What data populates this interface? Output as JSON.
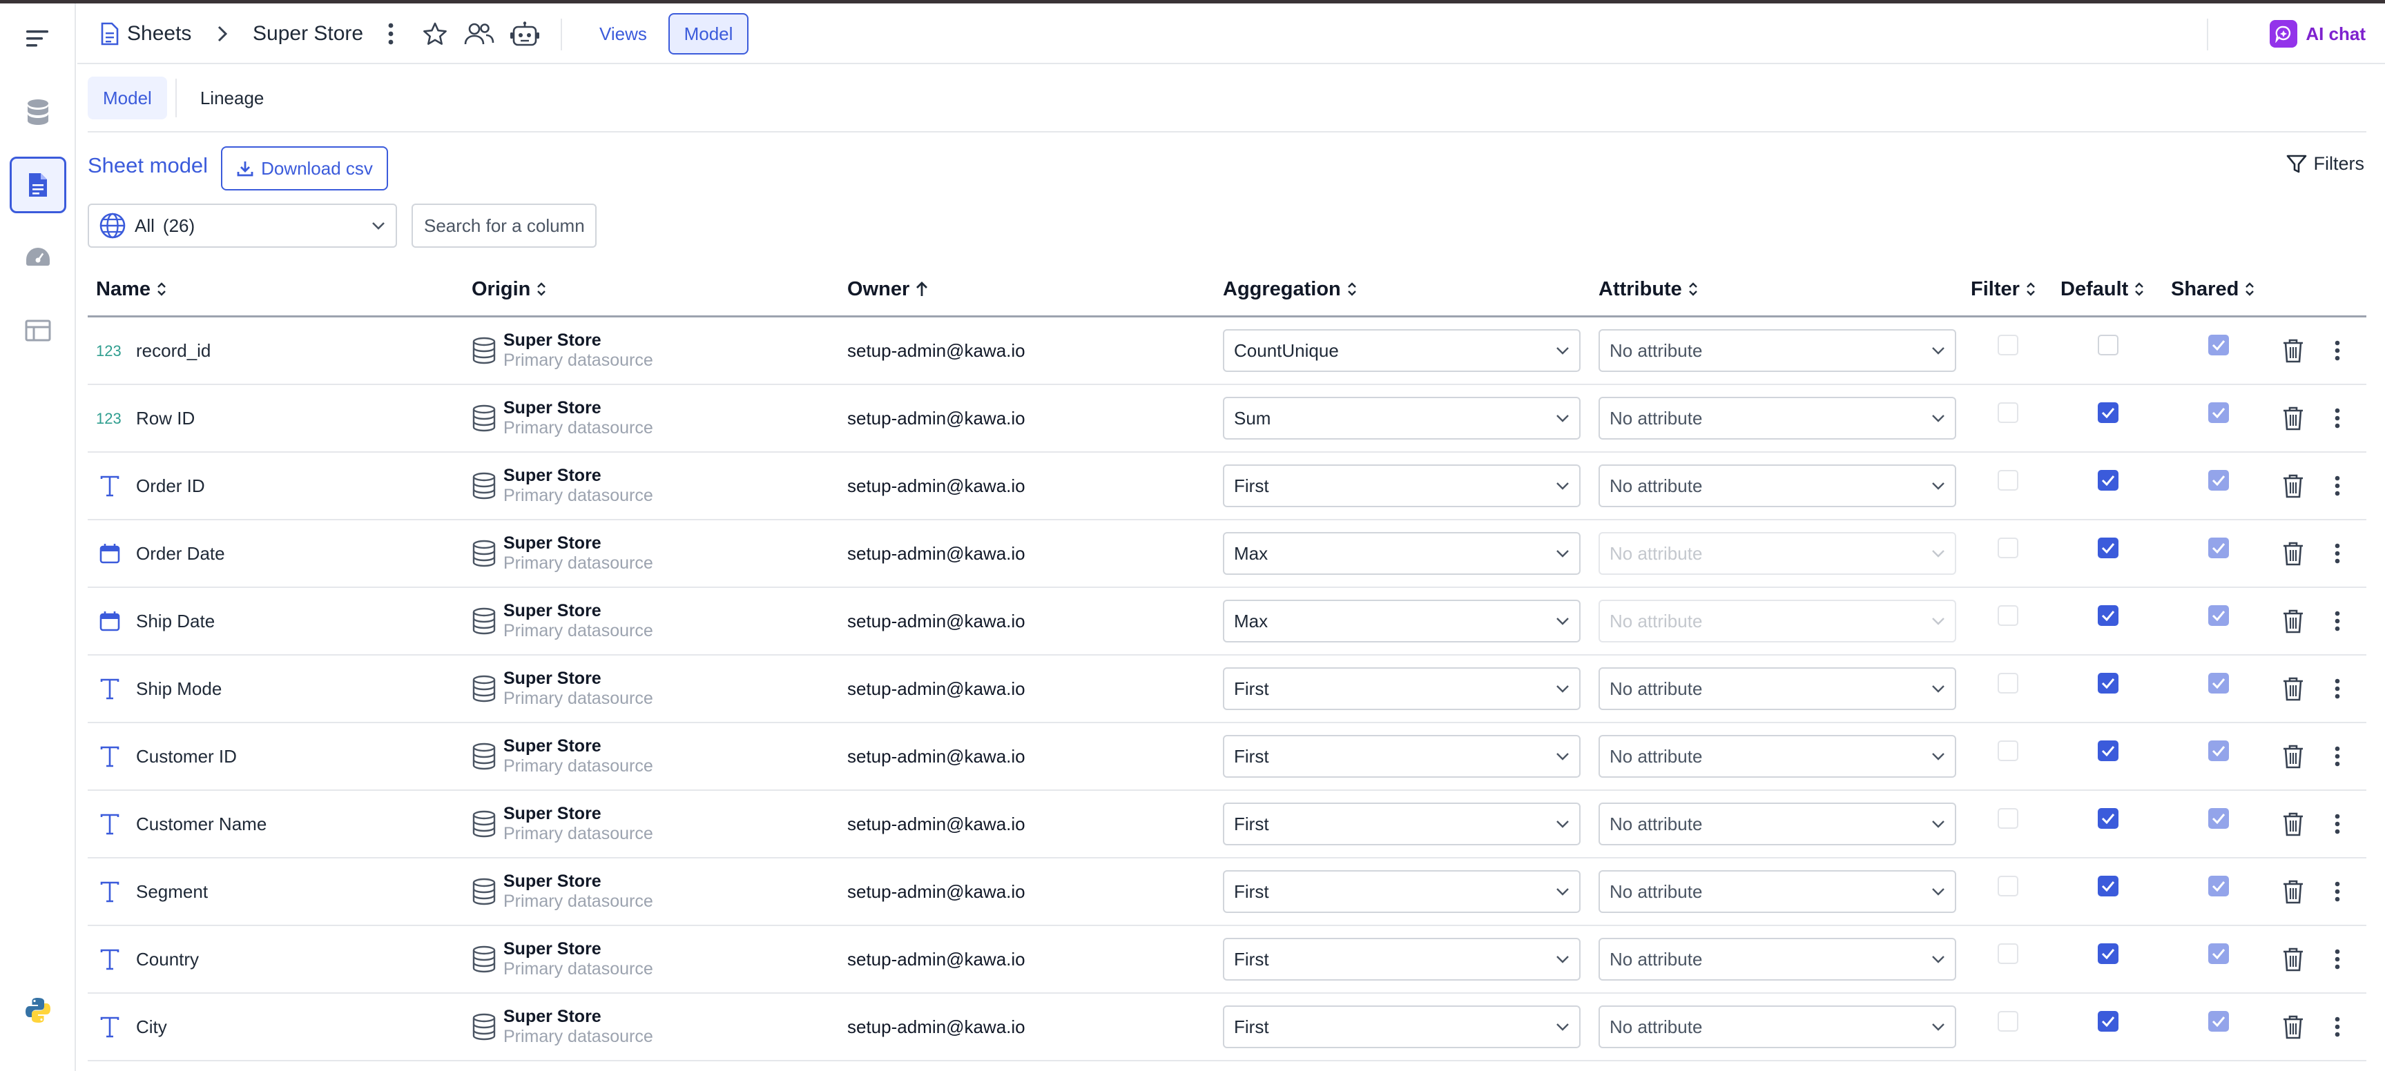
{
  "topbar": {
    "breadcrumb_root": "Sheets",
    "sheet_name": "Super Store",
    "views_label": "Views",
    "model_label": "Model",
    "ai_chat_label": "AI chat"
  },
  "sidebar": {
    "items": [
      {
        "icon": "menu-icon"
      },
      {
        "icon": "database-icon"
      },
      {
        "icon": "sheet-icon",
        "active": true
      },
      {
        "icon": "dashboard-icon"
      },
      {
        "icon": "table-icon"
      },
      {
        "icon": "python-icon"
      }
    ]
  },
  "tabs": [
    {
      "label": "Model",
      "active": true
    },
    {
      "label": "Lineage",
      "active": false
    }
  ],
  "sheet_model": {
    "title": "Sheet model",
    "download_label": "Download csv",
    "filters_label": "Filters",
    "column_filter": "All",
    "column_count": "(26)",
    "search_placeholder": "Search for a column"
  },
  "columns": {
    "name": "Name",
    "origin": "Origin",
    "owner": "Owner",
    "aggregation": "Aggregation",
    "attribute": "Attribute",
    "filter": "Filter",
    "default": "Default",
    "shared": "Shared"
  },
  "rows": [
    {
      "type": "number",
      "name": "record_id",
      "origin": "Super Store",
      "origin_sub": "Primary datasource",
      "owner": "setup-admin@kawa.io",
      "aggregation": "CountUnique",
      "attribute": "No attribute",
      "attribute_disabled": false,
      "filter": false,
      "default": false,
      "shared": true
    },
    {
      "type": "number",
      "name": "Row ID",
      "origin": "Super Store",
      "origin_sub": "Primary datasource",
      "owner": "setup-admin@kawa.io",
      "aggregation": "Sum",
      "attribute": "No attribute",
      "attribute_disabled": false,
      "filter": false,
      "default": true,
      "shared": true
    },
    {
      "type": "text",
      "name": "Order ID",
      "origin": "Super Store",
      "origin_sub": "Primary datasource",
      "owner": "setup-admin@kawa.io",
      "aggregation": "First",
      "attribute": "No attribute",
      "attribute_disabled": false,
      "filter": false,
      "default": true,
      "shared": true
    },
    {
      "type": "date",
      "name": "Order Date",
      "origin": "Super Store",
      "origin_sub": "Primary datasource",
      "owner": "setup-admin@kawa.io",
      "aggregation": "Max",
      "attribute": "No attribute",
      "attribute_disabled": true,
      "filter": false,
      "default": true,
      "shared": true
    },
    {
      "type": "date",
      "name": "Ship Date",
      "origin": "Super Store",
      "origin_sub": "Primary datasource",
      "owner": "setup-admin@kawa.io",
      "aggregation": "Max",
      "attribute": "No attribute",
      "attribute_disabled": true,
      "filter": false,
      "default": true,
      "shared": true
    },
    {
      "type": "text",
      "name": "Ship Mode",
      "origin": "Super Store",
      "origin_sub": "Primary datasource",
      "owner": "setup-admin@kawa.io",
      "aggregation": "First",
      "attribute": "No attribute",
      "attribute_disabled": false,
      "filter": false,
      "default": true,
      "shared": true
    },
    {
      "type": "text",
      "name": "Customer ID",
      "origin": "Super Store",
      "origin_sub": "Primary datasource",
      "owner": "setup-admin@kawa.io",
      "aggregation": "First",
      "attribute": "No attribute",
      "attribute_disabled": false,
      "filter": false,
      "default": true,
      "shared": true
    },
    {
      "type": "text",
      "name": "Customer Name",
      "origin": "Super Store",
      "origin_sub": "Primary datasource",
      "owner": "setup-admin@kawa.io",
      "aggregation": "First",
      "attribute": "No attribute",
      "attribute_disabled": false,
      "filter": false,
      "default": true,
      "shared": true
    },
    {
      "type": "text",
      "name": "Segment",
      "origin": "Super Store",
      "origin_sub": "Primary datasource",
      "owner": "setup-admin@kawa.io",
      "aggregation": "First",
      "attribute": "No attribute",
      "attribute_disabled": false,
      "filter": false,
      "default": true,
      "shared": true
    },
    {
      "type": "text",
      "name": "Country",
      "origin": "Super Store",
      "origin_sub": "Primary datasource",
      "owner": "setup-admin@kawa.io",
      "aggregation": "First",
      "attribute": "No attribute",
      "attribute_disabled": false,
      "filter": false,
      "default": true,
      "shared": true
    },
    {
      "type": "text",
      "name": "City",
      "origin": "Super Store",
      "origin_sub": "Primary datasource",
      "owner": "setup-admin@kawa.io",
      "aggregation": "First",
      "attribute": "No attribute",
      "attribute_disabled": false,
      "filter": false,
      "default": true,
      "shared": true
    }
  ],
  "colors": {
    "accent": "#3b5bdb",
    "shared_check": "#93a4ea",
    "ai": "#9333ea"
  }
}
